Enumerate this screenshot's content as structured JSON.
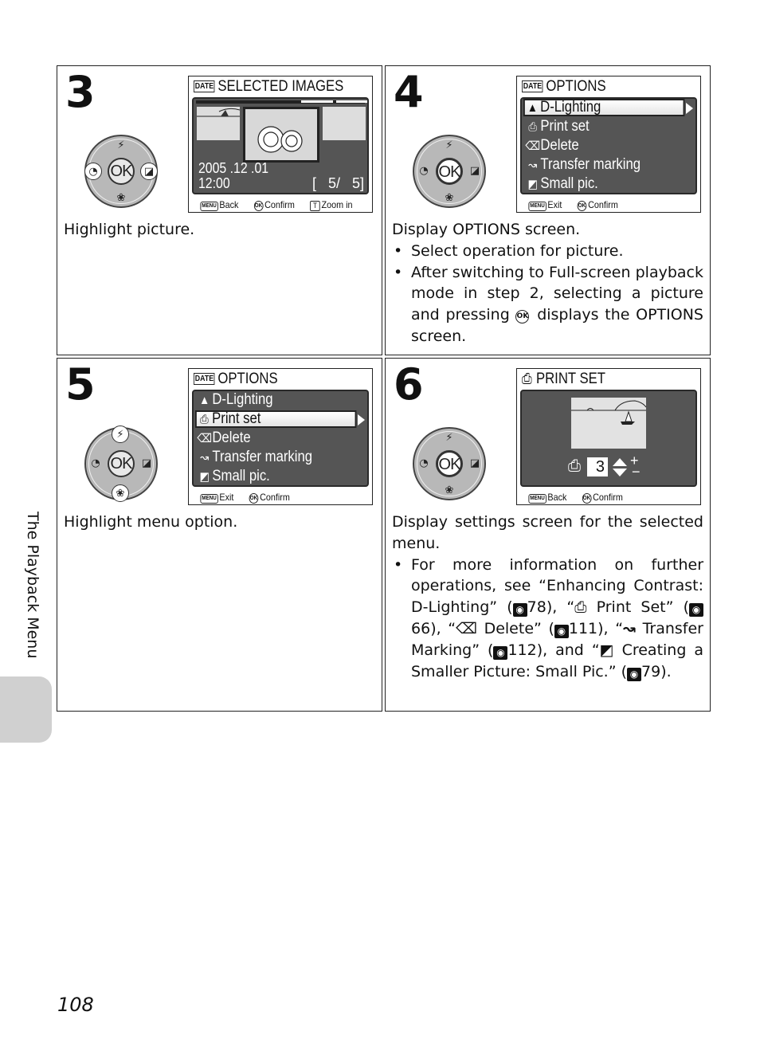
{
  "side_tab": {
    "label": "The Playback Menu"
  },
  "page_number": "108",
  "icons": {
    "date": "DATE",
    "menu_key": "MENU",
    "ok_key": "OK",
    "t_key": "T",
    "reference_eye": "reference-eye-icon",
    "print": "⎙",
    "trash": "🗑",
    "transfer": "↝",
    "small_pic": "▭",
    "d_lighting": "▲"
  },
  "dial": {
    "ok_label": "OK",
    "up": "⚡",
    "down": "❀",
    "left": "◔",
    "right": "◪"
  },
  "steps": [
    {
      "number": "3",
      "screen": {
        "title": "SELECTED IMAGES",
        "date": "2005 .12 .01",
        "time": "12:00",
        "counter": "[   5/   5]",
        "footer": [
          {
            "key": "MENU",
            "label": "Back"
          },
          {
            "key": "OK",
            "label": "Confirm"
          },
          {
            "key": "T",
            "label": "Zoom in"
          }
        ]
      },
      "highlighted_button": "left",
      "caption": "Highlight picture.",
      "bullets": []
    },
    {
      "number": "4",
      "screen": {
        "title": "OPTIONS",
        "menu": [
          "D-Lighting",
          "Print set",
          "Delete",
          "Transfer marking",
          "Small pic."
        ],
        "selected_index": 0,
        "footer": [
          {
            "key": "MENU",
            "label": "Exit"
          },
          {
            "key": "OK",
            "label": "Confirm"
          }
        ]
      },
      "highlighted_button": "ok",
      "caption": "Display OPTIONS screen.",
      "bullets": [
        "Select operation for picture.",
        "After switching to Full-screen playback mode in step 2, selecting a picture and pressing",
        "displays the OPTIONS screen."
      ]
    },
    {
      "number": "5",
      "screen": {
        "title": "OPTIONS",
        "menu": [
          "D-Lighting",
          "Print set",
          "Delete",
          "Transfer marking",
          "Small pic."
        ],
        "selected_index": 1,
        "footer": [
          {
            "key": "MENU",
            "label": "Exit"
          },
          {
            "key": "OK",
            "label": "Confirm"
          }
        ]
      },
      "highlighted_button": "up-down",
      "caption": "Highlight menu option.",
      "bullets": []
    },
    {
      "number": "6",
      "screen": {
        "title": "PRINT SET",
        "quantity": "3",
        "plus": "+",
        "minus": "−",
        "footer": [
          {
            "key": "MENU",
            "label": "Back"
          },
          {
            "key": "OK",
            "label": "Confirm"
          }
        ]
      },
      "highlighted_button": "ok",
      "caption": "Display settings screen for the selected menu.",
      "bullet_parts": {
        "p1": "For more information on further operations, see “Enhancing Contrast: D-Lighting” (",
        "r1": "78",
        "p2": "), “",
        "p3": " Print Set” (",
        "r2": "66",
        "p4": "), “",
        "p5": " Delete” (",
        "r3": "111",
        "p6": "), “",
        "p7": " Transfer Marking” (",
        "r4": "112",
        "p8": "), and “",
        "p9": " Creating a Smaller Picture: Small Pic.” (",
        "r5": "79",
        "p10": ")."
      }
    }
  ]
}
